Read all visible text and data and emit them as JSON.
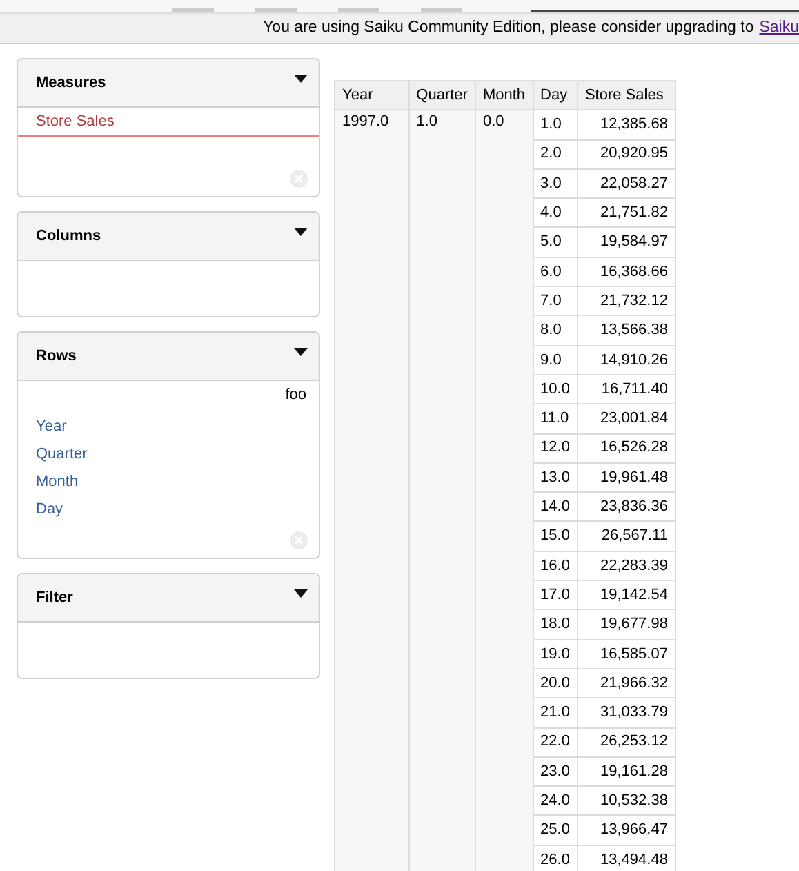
{
  "banner": {
    "text": "You are using Saiku Community Edition, please consider upgrading to",
    "link": "Saiku"
  },
  "panels": [
    {
      "title": "Measures",
      "items": [
        {
          "label": "Store Sales",
          "kind": "measure"
        }
      ],
      "removable": true
    },
    {
      "title": "Columns",
      "removable": false
    },
    {
      "title": "Rows",
      "note": "foo",
      "items": [
        {
          "label": "Year",
          "kind": "level"
        },
        {
          "label": "Quarter",
          "kind": "level"
        },
        {
          "label": "Month",
          "kind": "level"
        },
        {
          "label": "Day",
          "kind": "level"
        }
      ],
      "removable": true
    },
    {
      "title": "Filter",
      "removable": false
    }
  ],
  "table": {
    "columns": [
      "Year",
      "Quarter",
      "Month",
      "Day",
      "Store Sales"
    ],
    "group": [
      "1997.0",
      "1.0",
      "0.0"
    ],
    "rows": [
      [
        "1.0",
        "12,385.68"
      ],
      [
        "2.0",
        "20,920.95"
      ],
      [
        "3.0",
        "22,058.27"
      ],
      [
        "4.0",
        "21,751.82"
      ],
      [
        "5.0",
        "19,584.97"
      ],
      [
        "6.0",
        "16,368.66"
      ],
      [
        "7.0",
        "21,732.12"
      ],
      [
        "8.0",
        "13,566.38"
      ],
      [
        "9.0",
        "14,910.26"
      ],
      [
        "10.0",
        "16,711.40"
      ],
      [
        "11.0",
        "23,001.84"
      ],
      [
        "12.0",
        "16,526.28"
      ],
      [
        "13.0",
        "19,961.48"
      ],
      [
        "14.0",
        "23,836.36"
      ],
      [
        "15.0",
        "26,567.11"
      ],
      [
        "16.0",
        "22,283.39"
      ],
      [
        "17.0",
        "19,142.54"
      ],
      [
        "18.0",
        "19,677.98"
      ],
      [
        "19.0",
        "16,585.07"
      ],
      [
        "20.0",
        "21,966.32"
      ],
      [
        "21.0",
        "31,033.79"
      ],
      [
        "22.0",
        "26,253.12"
      ],
      [
        "23.0",
        "19,161.28"
      ],
      [
        "24.0",
        "10,532.38"
      ],
      [
        "25.0",
        "13,966.47"
      ],
      [
        "26.0",
        "13,494.48"
      ]
    ]
  }
}
